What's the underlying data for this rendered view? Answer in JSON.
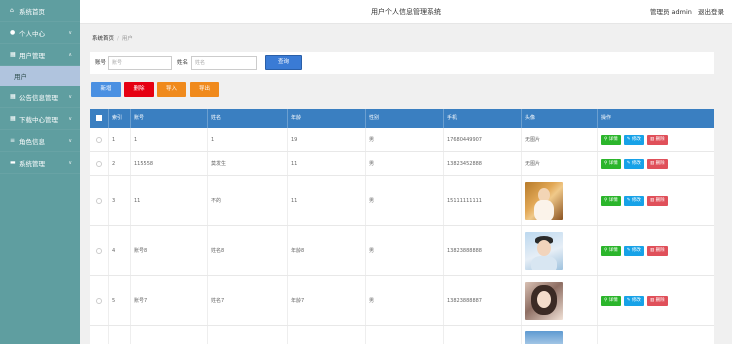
{
  "sidebar": {
    "items": [
      {
        "label": "系统首页",
        "icon": "home-icon",
        "glyph": "⌂",
        "chevron": ""
      },
      {
        "label": "个人中心",
        "icon": "user-icon",
        "glyph": "●",
        "chevron": "∨"
      },
      {
        "label": "用户管理",
        "icon": "grid-icon",
        "glyph": "▦",
        "chevron": "∧"
      },
      {
        "label": "公告信息管理",
        "icon": "grid-icon",
        "glyph": "▦",
        "chevron": "∨"
      },
      {
        "label": "下载中心管理",
        "icon": "grid-icon",
        "glyph": "▦",
        "chevron": "∨"
      },
      {
        "label": "角色信息",
        "icon": "list-icon",
        "glyph": "≡",
        "chevron": "∨"
      },
      {
        "label": "系统管理",
        "icon": "monitor-icon",
        "glyph": "▬",
        "chevron": "∨"
      }
    ],
    "sub_item": "用户"
  },
  "header": {
    "title": "用户个人信息管理系统",
    "role": "管理员",
    "user": "admin",
    "logout": "退出登录"
  },
  "breadcrumb": {
    "home": "系统首页",
    "current": "用户"
  },
  "search": {
    "account_label": "账号",
    "account_placeholder": "账号",
    "name_label": "姓名",
    "name_placeholder": "姓名",
    "query_button": "查询"
  },
  "actions": {
    "add": "新增",
    "delete": "删除",
    "import": "导入",
    "export": "导出"
  },
  "table": {
    "headers": [
      "",
      "索引",
      "账号",
      "姓名",
      "年龄",
      "性别",
      "手机",
      "头像",
      "操作"
    ],
    "rows": [
      {
        "index": "1",
        "account": "1",
        "name": "1",
        "age": "19",
        "gender": "男",
        "phone": "17680449907",
        "avatar": "无图片"
      },
      {
        "index": "2",
        "account": "115558",
        "name": "莫发生",
        "age": "11",
        "gender": "男",
        "phone": "13823452888",
        "avatar": "无图片"
      },
      {
        "index": "3",
        "account": "11",
        "name": "不的",
        "age": "11",
        "gender": "男",
        "phone": "15111111111",
        "avatar": ""
      },
      {
        "index": "4",
        "account": "账号8",
        "name": "姓名8",
        "age": "年龄8",
        "gender": "男",
        "phone": "13823888888",
        "avatar": ""
      },
      {
        "index": "5",
        "account": "账号7",
        "name": "姓名7",
        "age": "年龄7",
        "gender": "男",
        "phone": "13823888887",
        "avatar": ""
      }
    ],
    "ops": {
      "detail": "详情",
      "edit": "修改",
      "delete": "删除"
    }
  },
  "colors": {
    "sidebar": "#5f9ea0",
    "header_row": "#3a7fc1",
    "add": "#4a90e2",
    "delete": "#e60012",
    "import": "#f08a1c",
    "export": "#f08a1c"
  }
}
